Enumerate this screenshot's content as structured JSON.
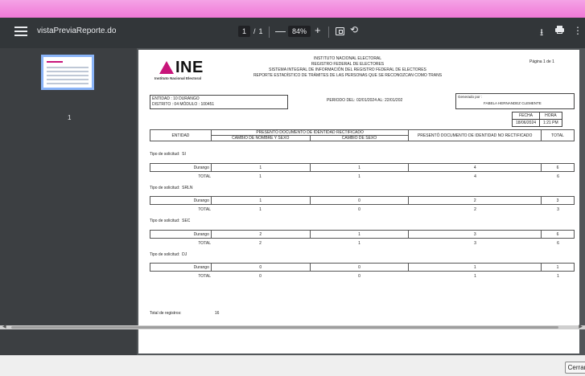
{
  "toolbar": {
    "title": "vistaPreviaReporte.do",
    "current_page": "1",
    "page_sep": "/",
    "total_pages": "1",
    "zoom_minus": "—",
    "zoom": "84%",
    "zoom_plus": "+",
    "rotate_icon": "⟲",
    "download_icon": "⭳",
    "more_icon": "⋮"
  },
  "sidebar": {
    "thumb_number": "1"
  },
  "report": {
    "logo_word": "INE",
    "logo_sub": "Instituto Nacional Electoral",
    "header_lines": [
      "INSTITUTO NACIONAL ELECTORAL",
      "REGISTRO FEDERAL DE ELECTORES",
      "SISTEMA INTEGRAL DE INFORMACIÓN DEL REGISTRO FEDERAL DE ELECTORES",
      "REPORTE ESTADÍSTICO DE TRÁMITES DE LAS PERSONAS QUE SE RECONOZCAN COMO TRANS"
    ],
    "page_label": "Página 1 de 1",
    "entidad_line": "ENTIDAD :  10     DURANGO",
    "distrito_line": "DISTRITO :  04     MÓDULO :  100451",
    "periodo_label": "PERIODO DEL:",
    "periodo_from": "02/01/2024",
    "periodo_al": "AL:",
    "periodo_to": "22/01/202",
    "generado_label": "Generado por :",
    "generado_name": "FABELA HERNANDEZ CLEMENTE",
    "fecha_label": "FECHA",
    "hora_label": "HORA",
    "fecha_value": "18/06/2024",
    "hora_value": "1:21 PM",
    "col_entidad": "ENTIDAD",
    "col_group": "PRESENTÓ DOCUMENTO DE IDENTIDAD RECTIFICADO",
    "col_cambio_nombre": "CAMBIO DE NOMBRE Y SEXO",
    "col_cambio_sexo": "CAMBIO DE SEXO",
    "col_no_rect": "PRESENTÓ DOCUMENTO DE IDENTIDAD NO RECTIFICADO",
    "col_total": "TOTAL",
    "tipo_label": "Tipo de solicitud:",
    "groups": [
      {
        "tipo": "SI",
        "estado": "Durango",
        "nombre": "1",
        "sexo": "1",
        "no_rect": "4",
        "total": "6",
        "tot_label": "TOTAL",
        "tot_nombre": "1",
        "tot_sexo": "1",
        "tot_no_rect": "4",
        "tot_total": "6"
      },
      {
        "tipo": "SRLN",
        "estado": "Durango",
        "nombre": "1",
        "sexo": "0",
        "no_rect": "2",
        "total": "3",
        "tot_label": "TOTAL",
        "tot_nombre": "1",
        "tot_sexo": "0",
        "tot_no_rect": "2",
        "tot_total": "3"
      },
      {
        "tipo": "SEC",
        "estado": "Durango",
        "nombre": "2",
        "sexo": "1",
        "no_rect": "3",
        "total": "6",
        "tot_label": "TOTAL",
        "tot_nombre": "2",
        "tot_sexo": "1",
        "tot_no_rect": "3",
        "tot_total": "6"
      },
      {
        "tipo": "DJ",
        "estado": "Durango",
        "nombre": "0",
        "sexo": "0",
        "no_rect": "1",
        "total": "1",
        "tot_label": "TOTAL",
        "tot_nombre": "0",
        "tot_sexo": "0",
        "tot_no_rect": "1",
        "tot_total": "1"
      }
    ],
    "total_registros_label": "Total de registros:",
    "total_registros_value": "16"
  },
  "footer": {
    "close_label": "Cerrar"
  },
  "colors": {
    "brand": "#c8157a",
    "toolbar": "#323639",
    "viewer_bg": "#525659",
    "top_bar": "#f078d6"
  }
}
